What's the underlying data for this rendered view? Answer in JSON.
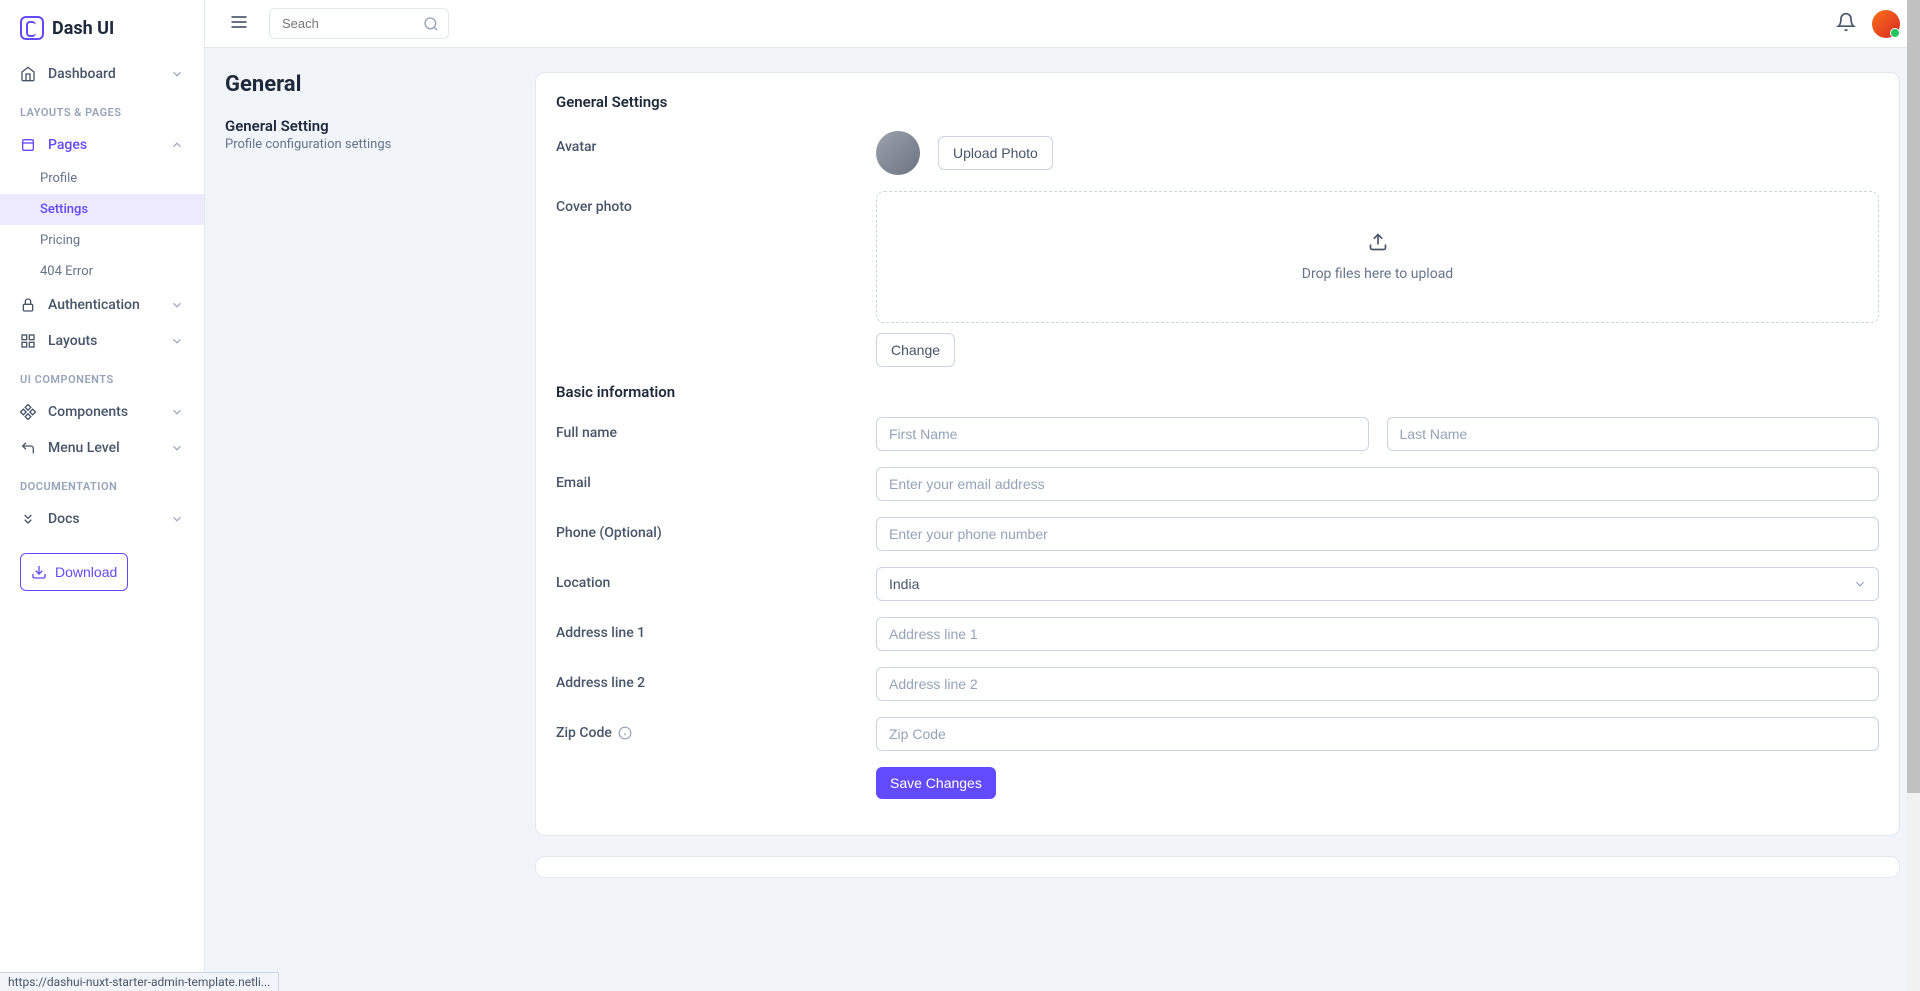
{
  "brand": "Dash UI",
  "search": {
    "placeholder": "Seach"
  },
  "nav": {
    "dashboard": "Dashboard",
    "section_layouts": "LAYOUTS & PAGES",
    "pages": "Pages",
    "pages_sub": {
      "profile": "Profile",
      "settings": "Settings",
      "pricing": "Pricing",
      "error404": "404 Error"
    },
    "authentication": "Authentication",
    "layouts": "Layouts",
    "section_ui": "UI COMPONENTS",
    "components": "Components",
    "menu_level": "Menu Level",
    "section_docs": "DOCUMENTATION",
    "docs": "Docs",
    "download": "Download"
  },
  "page": {
    "title": "General",
    "side_title": "General Setting",
    "side_sub": "Profile configuration settings"
  },
  "settings": {
    "general_title": "General Settings",
    "avatar_label": "Avatar",
    "upload_photo": "Upload Photo",
    "cover_label": "Cover photo",
    "dropzone_text": "Drop files here to upload",
    "change": "Change",
    "basic_title": "Basic information",
    "full_name": "Full name",
    "first_name_ph": "First Name",
    "last_name_ph": "Last Name",
    "email": "Email",
    "email_ph": "Enter your email address",
    "phone": "Phone (Optional)",
    "phone_ph": "Enter your phone number",
    "location": "Location",
    "location_value": "India",
    "addr1": "Address line 1",
    "addr1_ph": "Address line 1",
    "addr2": "Address line 2",
    "addr2_ph": "Address line 2",
    "zip": "Zip Code",
    "zip_ph": "Zip Code",
    "save": "Save Changes"
  },
  "status_url": "https://dashui-nuxt-starter-admin-template.netli..."
}
